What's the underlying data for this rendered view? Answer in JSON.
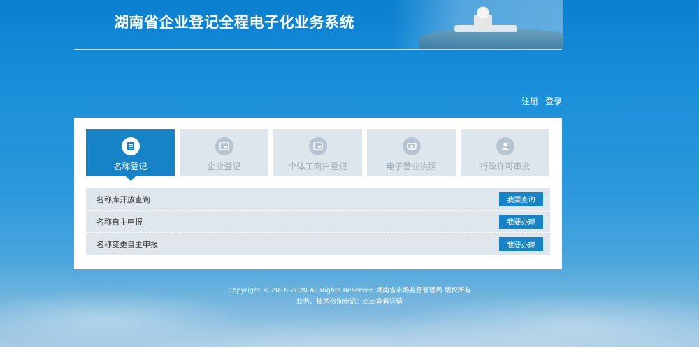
{
  "header": {
    "site_title": "湖南省企业登记全程电子化业务系统"
  },
  "auth": {
    "register_label": "注册",
    "login_label": "登录"
  },
  "tabs": [
    {
      "label": "名称登记",
      "icon": "document-list-icon",
      "active": true
    },
    {
      "label": "企业登记",
      "icon": "certificate-icon",
      "active": false
    },
    {
      "label": "个体工商户登记",
      "icon": "certificate-icon",
      "active": false
    },
    {
      "label": "电子营业执照",
      "icon": "license-icon",
      "active": false
    },
    {
      "label": "行政许可审批",
      "icon": "person-icon",
      "active": false
    }
  ],
  "services": [
    {
      "label": "名称库开放查询",
      "button": "我要查询"
    },
    {
      "label": "名称自主申报",
      "button": "我要办理"
    },
    {
      "label": "名称变更自主申报",
      "button": "我要办理"
    }
  ],
  "footer": {
    "copyright": "Copyright © 2016-2020 All Rights Reserved 湖南省市场监督管理局 版权所有",
    "contact_prefix": "业务、技术咨询电话：",
    "contact_link": "点击查看详情"
  },
  "colors": {
    "accent": "#1583c6",
    "tab_inactive": "#dde6ec",
    "row_bg": "#dfe6ec"
  }
}
